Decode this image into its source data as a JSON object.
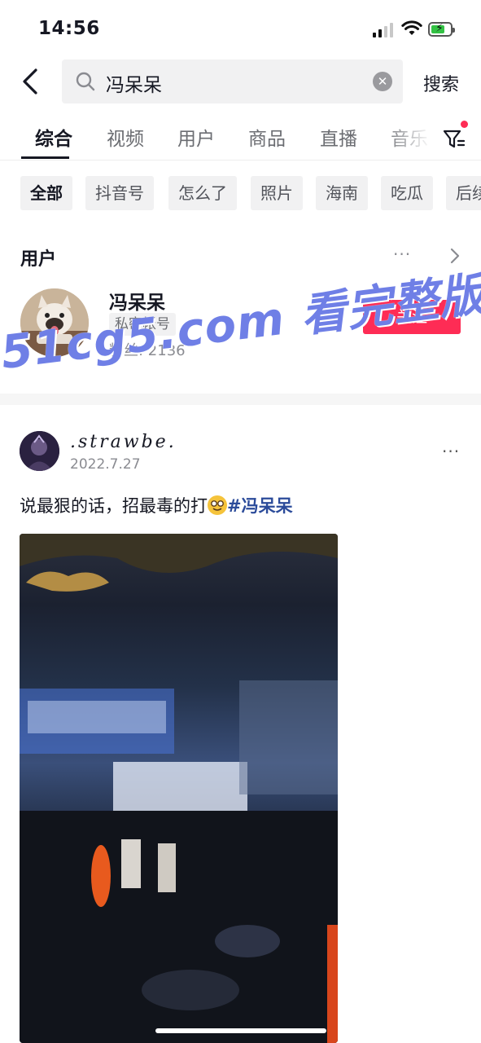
{
  "status": {
    "time": "14:56"
  },
  "search": {
    "query": "冯呆呆",
    "button_label": "搜索"
  },
  "tabs": [
    {
      "label": "综合",
      "active": true
    },
    {
      "label": "视频"
    },
    {
      "label": "用户"
    },
    {
      "label": "商品"
    },
    {
      "label": "直播"
    },
    {
      "label": "音乐"
    }
  ],
  "chips": [
    {
      "label": "全部",
      "active": true
    },
    {
      "label": "抖音号"
    },
    {
      "label": "怎么了"
    },
    {
      "label": "照片"
    },
    {
      "label": "海南"
    },
    {
      "label": "吃瓜"
    },
    {
      "label": "后续"
    }
  ],
  "user_section": {
    "title": "用户",
    "more": "···",
    "user": {
      "name": "冯呆呆",
      "tag": "私密帐号",
      "fans": "粉丝: 2136",
      "follow_label": "关注"
    }
  },
  "watermark": "51cg5.com 看完整版",
  "post": {
    "author": ".strawbe.",
    "date": "2022.7.27",
    "more": "···",
    "text": "说最狠的话，招最毒的打",
    "hashtag": "#冯呆呆"
  },
  "colors": {
    "accent": "#fe2c55",
    "hashtag": "#2b4b9a",
    "watermark": "#6f7fe6",
    "battery": "#33c244"
  },
  "icons": [
    "back-arrow-icon",
    "search-icon",
    "clear-icon",
    "filter-icon",
    "chevron-right-icon",
    "more-icon",
    "wifi-icon",
    "signal-icon",
    "battery-icon"
  ]
}
